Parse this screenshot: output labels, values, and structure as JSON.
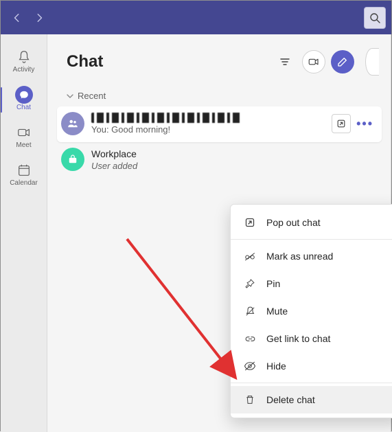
{
  "rail": {
    "activity": "Activity",
    "chat": "Chat",
    "meet": "Meet",
    "calendar": "Calendar"
  },
  "header": {
    "title": "Chat"
  },
  "section": {
    "recent": "Recent"
  },
  "chats": [
    {
      "preview": "You: Good morning!"
    },
    {
      "name": "Workplace",
      "preview": "User added"
    }
  ],
  "menu": {
    "popout": "Pop out chat",
    "unread": "Mark as unread",
    "pin": "Pin",
    "mute": "Mute",
    "link": "Get link to chat",
    "hide": "Hide",
    "delete": "Delete chat"
  }
}
